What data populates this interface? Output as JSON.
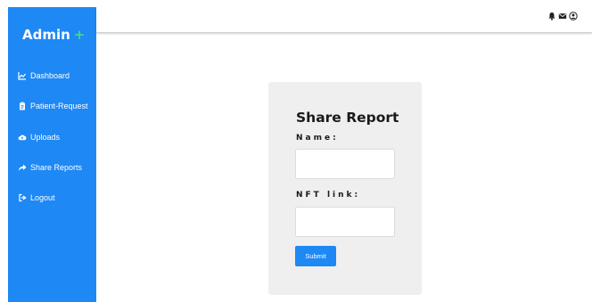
{
  "app": {
    "brand": "Admin",
    "brand_plus": "+"
  },
  "sidebar": {
    "items": [
      {
        "label": "Dashboard",
        "icon": "chart-line-icon"
      },
      {
        "label": "Patient-Request",
        "icon": "clipboard-icon"
      },
      {
        "label": "Uploads",
        "icon": "cloud-upload-icon"
      },
      {
        "label": "Share Reports",
        "icon": "share-arrow-icon"
      },
      {
        "label": "Logout",
        "icon": "sign-out-icon"
      }
    ]
  },
  "topbar": {
    "icons": [
      "bell-icon",
      "envelope-icon",
      "user-circle-icon"
    ]
  },
  "form": {
    "title": "Share Report",
    "name_label": "Name:",
    "name_value": "",
    "nft_label": "NFT link:",
    "nft_value": "",
    "submit_label": "Submit"
  },
  "colors": {
    "accent": "#1e88f5",
    "brand_plus": "#3ddc84",
    "card_bg": "#efefef"
  }
}
